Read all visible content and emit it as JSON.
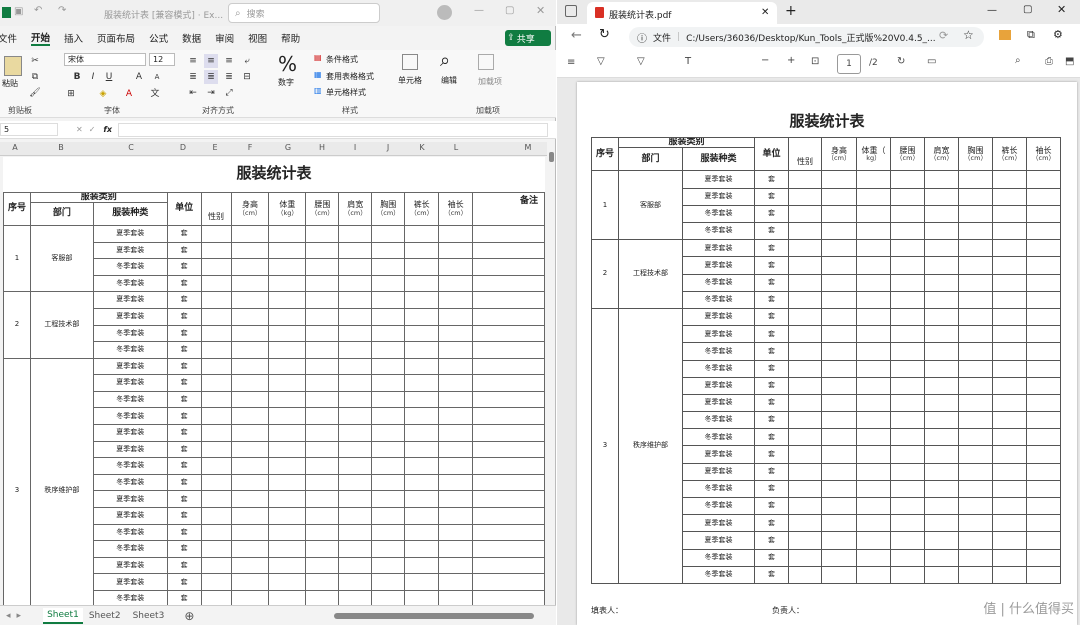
{
  "excel": {
    "title": "服装统计表 [兼容模式]  · Ex...",
    "search_placeholder": "搜索",
    "ribbon_tabs": [
      "文件",
      "开始",
      "插入",
      "页面布局",
      "公式",
      "数据",
      "审阅",
      "视图",
      "帮助"
    ],
    "share_label": "共享",
    "font_name": "宋体",
    "font_size": "12",
    "paste_label": "粘贴",
    "clipboard_label": "剪贴板",
    "font_label": "字体",
    "align_label": "对齐方式",
    "number_label": "数字",
    "cond_format": "条件格式",
    "table_format": "套用表格格式",
    "cell_style": "单元格样式",
    "style_label": "样式",
    "cells_label": "单元格",
    "edit_label": "编辑",
    "addin_label1": "加载项",
    "addin_label2": "加载项",
    "name_box": "5",
    "fx": "fx",
    "columns": [
      "A",
      "B",
      "C",
      "D",
      "E",
      "F",
      "G",
      "H",
      "I",
      "J",
      "K",
      "L",
      "M"
    ],
    "sheets": [
      "Sheet1",
      "Sheet2",
      "Sheet3"
    ]
  },
  "edge": {
    "tab_title": "服装统计表.pdf",
    "address_prefix": "文件",
    "url": "C:/Users/36036/Desktop/Kun_Tools_正式版%20V0.4.5_...",
    "page_current": "1",
    "page_total": "/2"
  },
  "table": {
    "title": "服装统计表",
    "h_seq": "序号",
    "h_category": "服装类别",
    "h_dept": "部门",
    "h_type": "服装种类",
    "h_unit": "单位",
    "h_gender": "性别",
    "h_height": "身高",
    "h_height_u": "（cm）",
    "h_weight": "体重",
    "h_weight_u": "（kg）",
    "h_waist": "腰围",
    "h_waist_u": "（cm）",
    "h_shoulder": "肩宽",
    "h_shoulder_u": "（cm）",
    "h_chest": "胸围",
    "h_chest_u": "（cm）",
    "h_pants": "裤长",
    "h_pants_u": "（cm）",
    "h_sleeve": "袖长",
    "h_sleeve_u": "（cm）",
    "h_remark": "备注",
    "pdf_weight": "体重（",
    "pdf_weight_u": "kg）",
    "groups": [
      {
        "no": "1",
        "dept": "客服部",
        "rows": [
          [
            "夏季套装",
            "套"
          ],
          [
            "夏季套装",
            "套"
          ],
          [
            "冬季套装",
            "套"
          ],
          [
            "冬季套装",
            "套"
          ]
        ]
      },
      {
        "no": "2",
        "dept": "工程技术部",
        "rows": [
          [
            "夏季套装",
            "套"
          ],
          [
            "夏季套装",
            "套"
          ],
          [
            "冬季套装",
            "套"
          ],
          [
            "冬季套装",
            "套"
          ]
        ]
      },
      {
        "no": "3",
        "dept": "秩序维护部",
        "rows": [
          [
            "夏季套装",
            "套"
          ],
          [
            "夏季套装",
            "套"
          ],
          [
            "冬季套装",
            "套"
          ],
          [
            "冬季套装",
            "套"
          ],
          [
            "夏季套装",
            "套"
          ],
          [
            "夏季套装",
            "套"
          ],
          [
            "冬季套装",
            "套"
          ],
          [
            "冬季套装",
            "套"
          ],
          [
            "夏季套装",
            "套"
          ],
          [
            "夏季套装",
            "套"
          ],
          [
            "冬季套装",
            "套"
          ],
          [
            "冬季套装",
            "套"
          ],
          [
            "夏季套装",
            "套"
          ],
          [
            "夏季套装",
            "套"
          ],
          [
            "冬季套装",
            "套"
          ],
          [
            "冬季套装",
            "套"
          ]
        ]
      }
    ],
    "footer_filler": "填表人：",
    "footer_resp": "负责人："
  },
  "watermark": "值 | 什么值得买",
  "colors": {
    "excel_green": "#107c41",
    "pdf_red": "#d93025",
    "accent": "#1a73e8"
  }
}
